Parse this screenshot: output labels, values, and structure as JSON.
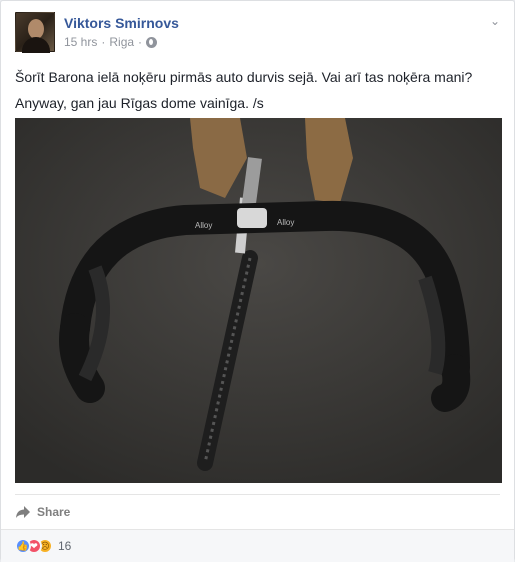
{
  "post": {
    "author": "Viktors Smirnovs",
    "time": "15 hrs",
    "separator": "·",
    "location": "Riga",
    "separator2": "·",
    "privacy_icon": "globe-icon",
    "menu_icon": "chevron-down-icon",
    "text_line1": "Šorīt Barona ielā noķēru pirmās auto durvis sejā. Vai arī tas noķēra mani?",
    "text_line2": "Anyway, gan jau Rīgas dome vainīga. /s",
    "photo_subject": "bicycle handlebars and shoes on pavement"
  },
  "actions": {
    "share_label": "Share",
    "share_icon": "share-arrow-icon"
  },
  "reactions": {
    "icons": [
      "like-icon",
      "love-icon",
      "sad-icon"
    ],
    "count": "16"
  },
  "colors": {
    "link": "#365899",
    "meta": "#90949c",
    "like": "#5890ff",
    "love": "#f25268",
    "sad": "#f7b125"
  }
}
